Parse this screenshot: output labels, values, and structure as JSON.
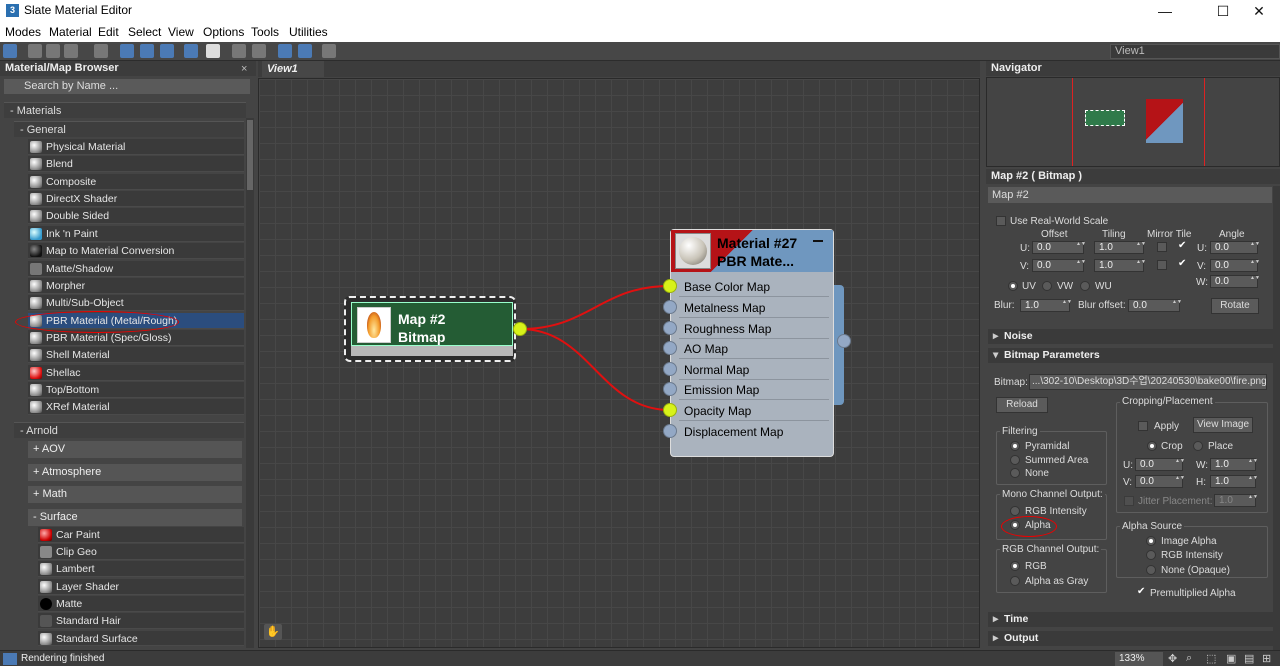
{
  "window": {
    "title": "Slate Material Editor",
    "app_icon": "3",
    "minimize": "—",
    "maximize": "☐",
    "close": "✕"
  },
  "menu": [
    "Modes",
    "Material",
    "Edit",
    "Select",
    "View",
    "Options",
    "Tools",
    "Utilities"
  ],
  "view_selector": "View1",
  "browser": {
    "title": "Material/Map Browser",
    "close": "×",
    "search_placeholder": "Search by Name ...",
    "materials_header": "- Materials",
    "general_header": "- General",
    "general_items": [
      "Physical Material",
      "Blend",
      "Composite",
      "DirectX Shader",
      "Double Sided",
      "Ink 'n Paint",
      "Map to Material Conversion",
      "Matte/Shadow",
      "Morpher",
      "Multi/Sub-Object",
      "PBR Material (Metal/Rough)",
      "PBR Material (Spec/Gloss)",
      "Shell Material",
      "Shellac",
      "Top/Bottom",
      "XRef Material"
    ],
    "arnold_header": "- Arnold",
    "arnold_groups": [
      "+ AOV",
      "+ Atmosphere",
      "+ Math"
    ],
    "surface_header": "- Surface",
    "surface_items": [
      "Car Paint",
      "Clip Geo",
      "Lambert",
      "Layer Shader",
      "Matte",
      "Standard Hair",
      "Standard Surface"
    ]
  },
  "view_tab": "View1",
  "bitmap_node": {
    "line1": "Map #2",
    "line2": "Bitmap"
  },
  "material_node": {
    "line1": "Material #27",
    "line2": "PBR Mate...",
    "slots": [
      "Base Color Map",
      "Metalness Map",
      "Roughness Map",
      "AO Map",
      "Normal Map",
      "Emission Map",
      "Opacity Map",
      "Displacement Map"
    ]
  },
  "navigator": {
    "title": "Navigator"
  },
  "params": {
    "title": "Map #2  ( Bitmap )",
    "name_field": "Map #2",
    "use_real_world": "Use Real-World Scale",
    "col_offset": "Offset",
    "col_tiling": "Tiling",
    "col_mirror": "Mirror Tile",
    "col_angle": "Angle",
    "u_label": "U:",
    "v_label": "V:",
    "w_label": "W:",
    "u_offset": "0.0",
    "u_tiling": "1.0",
    "u_angle": "0.0",
    "v_offset": "0.0",
    "v_tiling": "1.0",
    "v_angle": "0.0",
    "w_angle": "0.0",
    "uv": "UV",
    "vw": "VW",
    "wu": "WU",
    "blur_label": "Blur:",
    "blur_value": "1.0",
    "blur_offset_label": "Blur offset:",
    "blur_offset_value": "0.0",
    "rotate": "Rotate",
    "noise": "Noise",
    "bitmap_params": "Bitmap Parameters",
    "bitmap_label": "Bitmap:",
    "bitmap_path": "...\\302-10\\Desktop\\3D수업\\20240530\\bake00\\fire.png",
    "reload": "Reload",
    "cropping": "Cropping/Placement",
    "apply": "Apply",
    "view_image": "View Image",
    "crop": "Crop",
    "place": "Place",
    "crop_u": "0.0",
    "crop_v": "0.0",
    "crop_w_label": "W:",
    "crop_w": "1.0",
    "crop_h_label": "H:",
    "crop_h": "1.0",
    "jitter": "Jitter Placement:",
    "jitter_value": "1.0",
    "filtering": "Filtering",
    "pyramidal": "Pyramidal",
    "summed_area": "Summed Area",
    "none": "None",
    "mono_output": "Mono Channel Output:",
    "rgb_intensity": "RGB Intensity",
    "alpha": "Alpha",
    "alpha_source": "Alpha Source",
    "image_alpha": "Image Alpha",
    "rgb_intensity2": "RGB Intensity",
    "none_opaque": "None (Opaque)",
    "rgb_output": "RGB Channel Output:",
    "rgb": "RGB",
    "alpha_as_gray": "Alpha as Gray",
    "premultiplied": "Premultiplied Alpha",
    "time": "Time",
    "output": "Output"
  },
  "status": {
    "text": "Rendering finished",
    "zoom": "133%"
  }
}
